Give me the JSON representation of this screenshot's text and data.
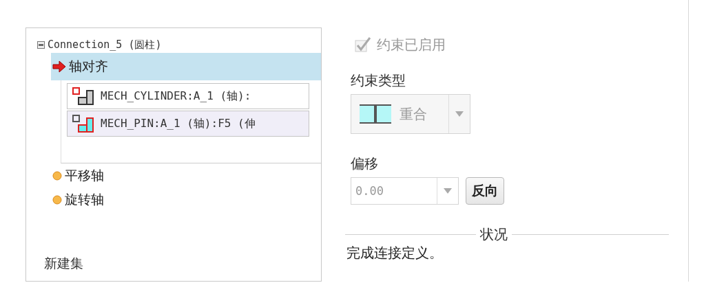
{
  "tree": {
    "root": {
      "label": "Connection_5 (圆柱)",
      "expanded": true,
      "children": [
        {
          "label": "轴对齐",
          "kind": "constraint",
          "selected": true,
          "references": [
            {
              "label": "MECH_CYLINDER:A_1 (轴):"
            },
            {
              "label": "MECH_PIN:A_1 (轴):F5 (伸"
            }
          ]
        },
        {
          "label": "平移轴",
          "kind": "axis",
          "selected": false
        },
        {
          "label": "旋转轴",
          "kind": "axis",
          "selected": false
        }
      ]
    },
    "new_set": "新建集"
  },
  "constraint_enabled": {
    "label": "约束已启用",
    "checked": true,
    "disabled": true
  },
  "constraint_type": {
    "label": "约束类型",
    "value": "重合",
    "disabled": true
  },
  "offset": {
    "label": "偏移",
    "value": "0.00",
    "disabled": true
  },
  "flip_button": "反向",
  "status": {
    "title": "状况",
    "message": "完成连接定义。"
  }
}
